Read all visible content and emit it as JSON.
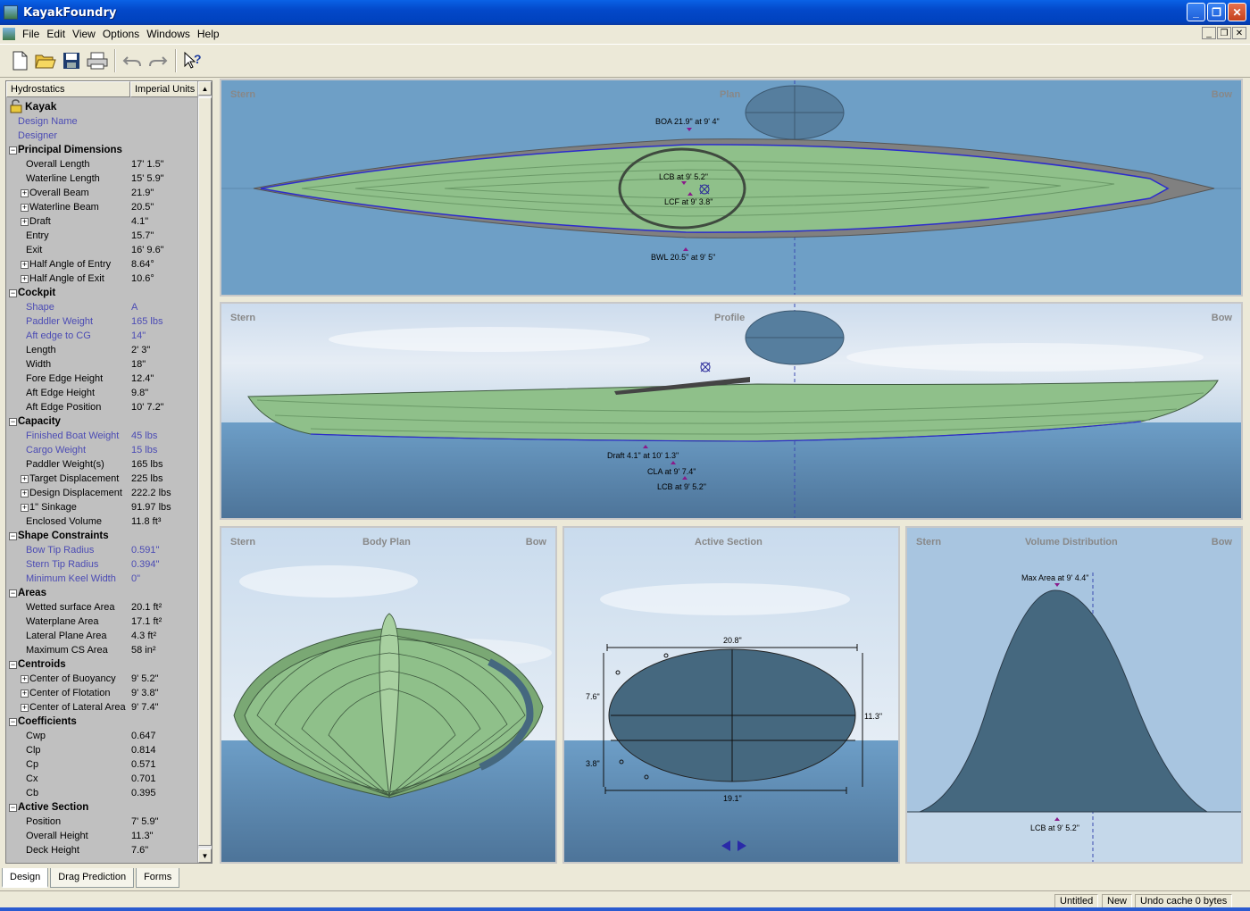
{
  "window": {
    "title": "KayakFoundry",
    "min": "_",
    "max": "❐",
    "close": "✕"
  },
  "menu": {
    "items": [
      "File",
      "Edit",
      "View",
      "Options",
      "Windows",
      "Help"
    ]
  },
  "toolbar": {
    "buttons": [
      "new",
      "open",
      "save",
      "print",
      "undo",
      "redo",
      "context-help"
    ]
  },
  "panel": {
    "header_left": "Hydrostatics",
    "header_right": "Imperial Units",
    "root": "Kayak",
    "rows": [
      {
        "n": "Design Name",
        "v": "",
        "t": "blue0"
      },
      {
        "n": "Designer",
        "v": "",
        "t": "blue0"
      },
      {
        "n": "Principal Dimensions",
        "t": "cat"
      },
      {
        "n": "Overall Length",
        "v": "17'  1.5\""
      },
      {
        "n": "Waterline Length",
        "v": "15'  5.9\""
      },
      {
        "n": "Overall Beam",
        "v": "21.9\"",
        "t": "plus"
      },
      {
        "n": "Waterline Beam",
        "v": "20.5\"",
        "t": "plus"
      },
      {
        "n": "Draft",
        "v": "4.1\"",
        "t": "plus"
      },
      {
        "n": "Entry",
        "v": "15.7\""
      },
      {
        "n": "Exit",
        "v": "16'  9.6\""
      },
      {
        "n": "Half Angle of Entry",
        "v": "8.64°",
        "t": "plus"
      },
      {
        "n": "Half Angle of Exit",
        "v": "10.6°",
        "t": "plus"
      },
      {
        "n": "Cockpit",
        "t": "cat"
      },
      {
        "n": "Shape",
        "v": "A",
        "t": "blue"
      },
      {
        "n": "Paddler Weight",
        "v": "165 lbs",
        "t": "blue"
      },
      {
        "n": "Aft edge to CG",
        "v": "14\"",
        "t": "blue"
      },
      {
        "n": "Length",
        "v": "2'  3\""
      },
      {
        "n": "Width",
        "v": "18\""
      },
      {
        "n": "Fore Edge Height",
        "v": "12.4\""
      },
      {
        "n": "Aft Edge Height",
        "v": "9.8\""
      },
      {
        "n": "Aft Edge Position",
        "v": "10'  7.2\""
      },
      {
        "n": "Capacity",
        "t": "cat"
      },
      {
        "n": "Finished Boat Weight",
        "v": "45 lbs",
        "t": "blue"
      },
      {
        "n": "Cargo Weight",
        "v": "15 lbs",
        "t": "blue"
      },
      {
        "n": "Paddler Weight(s)",
        "v": "165 lbs"
      },
      {
        "n": "Target Displacement",
        "v": "225 lbs",
        "t": "plus"
      },
      {
        "n": "Design Displacement",
        "v": "222.2 lbs",
        "t": "plus"
      },
      {
        "n": "1\" Sinkage",
        "v": "91.97 lbs",
        "t": "plus"
      },
      {
        "n": "Enclosed Volume",
        "v": "11.8 ft³"
      },
      {
        "n": "Shape Constraints",
        "t": "cat"
      },
      {
        "n": "Bow Tip Radius",
        "v": "0.591\"",
        "t": "blue"
      },
      {
        "n": "Stern Tip Radius",
        "v": "0.394\"",
        "t": "blue"
      },
      {
        "n": "Minimum Keel Width",
        "v": "0\"",
        "t": "blue"
      },
      {
        "n": "Areas",
        "t": "cat"
      },
      {
        "n": "Wetted surface Area",
        "v": "20.1 ft²"
      },
      {
        "n": "Waterplane Area",
        "v": "17.1 ft²"
      },
      {
        "n": "Lateral Plane Area",
        "v": "4.3 ft²"
      },
      {
        "n": "Maximum CS Area",
        "v": "58 in²"
      },
      {
        "n": "Centroids",
        "t": "cat"
      },
      {
        "n": "Center of Buoyancy",
        "v": "9'  5.2\"",
        "t": "plus"
      },
      {
        "n": "Center of Flotation",
        "v": "9'  3.8\"",
        "t": "plus"
      },
      {
        "n": "Center of Lateral Area",
        "v": "9'  7.4\"",
        "t": "plus"
      },
      {
        "n": "Coefficients",
        "t": "cat"
      },
      {
        "n": "Cwp",
        "v": "0.647"
      },
      {
        "n": "Clp",
        "v": "0.814"
      },
      {
        "n": "Cp",
        "v": "0.571"
      },
      {
        "n": "Cx",
        "v": "0.701"
      },
      {
        "n": "Cb",
        "v": "0.395"
      },
      {
        "n": "Active Section",
        "t": "cat"
      },
      {
        "n": "Position",
        "v": "7'  5.9\""
      },
      {
        "n": "Overall Height",
        "v": "11.3\""
      },
      {
        "n": "Deck Height",
        "v": "7.6\""
      }
    ]
  },
  "plan": {
    "stern": "Stern",
    "title": "Plan",
    "bow": "Bow",
    "boa": "BOA 21.9\" at 9'  4\"",
    "lcb": "LCB at 9'  5.2\"",
    "lcf": "LCF at 9'  3.8\"",
    "bwl": "BWL 20.5\" at 9'  5\""
  },
  "profile": {
    "stern": "Stern",
    "title": "Profile",
    "bow": "Bow",
    "draft": "Draft 4.1\" at 10'  1.3\"",
    "cla": "CLA at 9'  7.4\"",
    "lcb": "LCB at 9'  5.2\""
  },
  "body": {
    "stern": "Stern",
    "title": "Body Plan",
    "bow": "Bow"
  },
  "section": {
    "title": "Active Section",
    "w_top": "20.8\"",
    "w_bot": "19.1\"",
    "h_right": "11.3\"",
    "h_deck": "7.6\"",
    "h_draft": "3.8\""
  },
  "volume": {
    "stern": "Stern",
    "title": "Volume Distribution",
    "bow": "Bow",
    "max": "Max Area at 9'  4.4\"",
    "lcb": "LCB at 9'  5.2\""
  },
  "tabs": [
    "Design",
    "Drag Prediction",
    "Forms"
  ],
  "status": {
    "file": "Untitled",
    "state": "New",
    "undo": "Undo cache 0 bytes"
  },
  "colors": {
    "water": "#6fa0c6",
    "hull": "#8fc08a",
    "hull_dark": "#3f5a40",
    "section": "#45687f",
    "marker": "#8a1a8a"
  }
}
